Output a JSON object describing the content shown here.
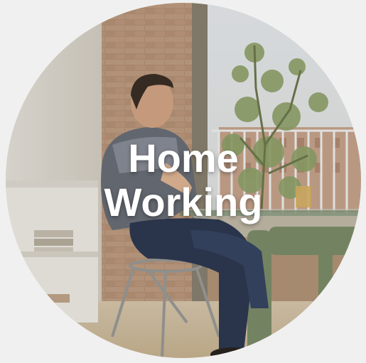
{
  "caption": {
    "line1": "Home",
    "line2": "Working"
  }
}
